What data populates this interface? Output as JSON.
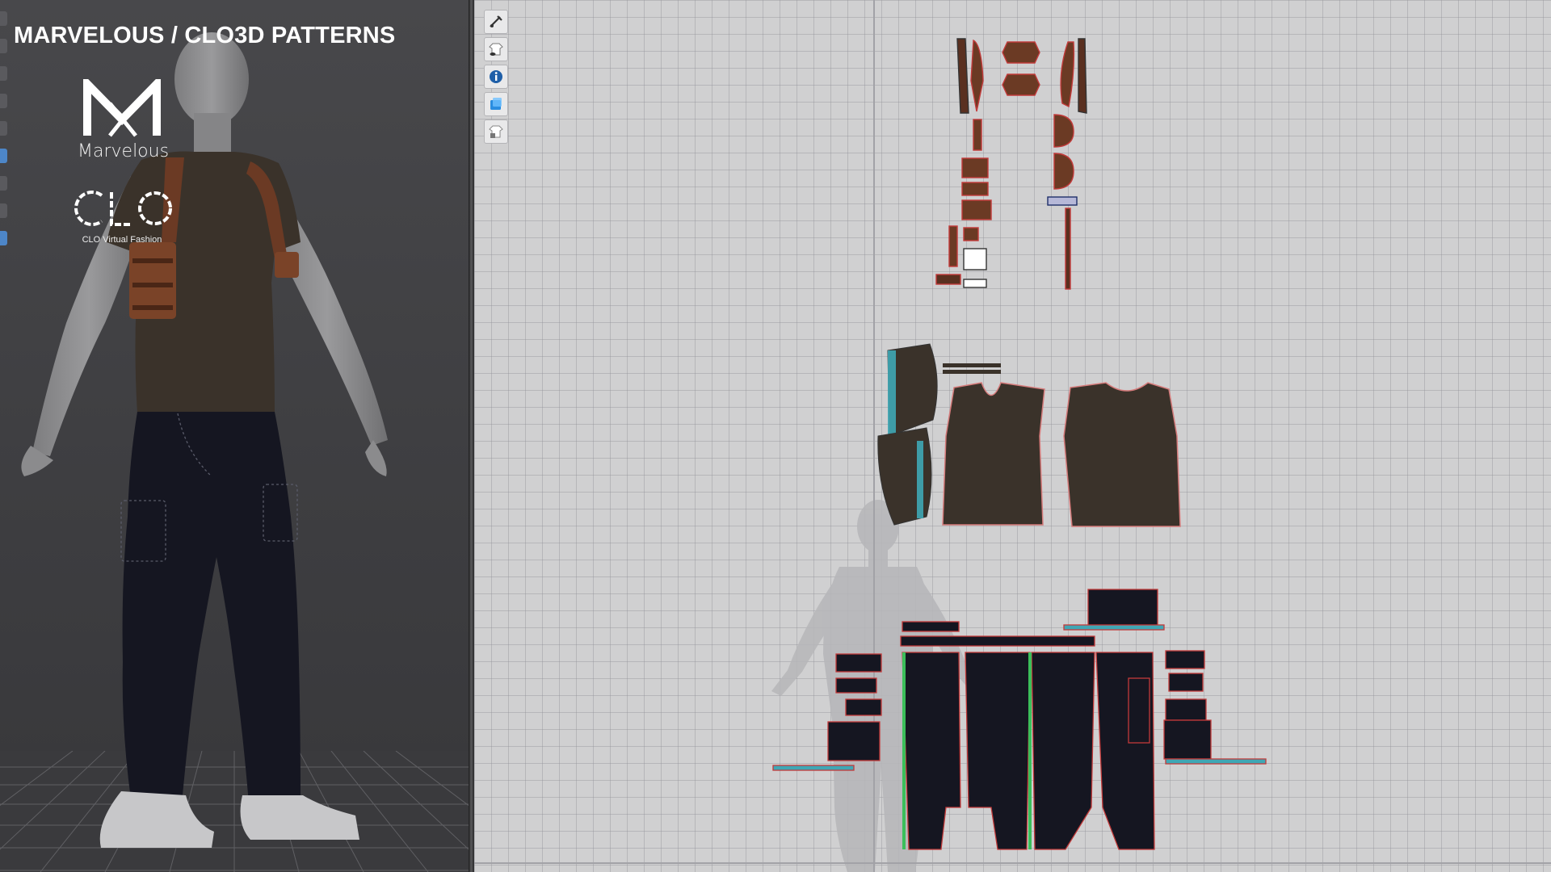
{
  "header": {
    "title": "MARVELOUS / CLO3D PATTERNS"
  },
  "brand": {
    "marvelous_label": "Marvelous",
    "clo_label": "CLO",
    "clo_tagline": "CLO Virtual Fashion"
  },
  "colors": {
    "bg3d": "#3f3f42",
    "grid2d": "#d0d0d1",
    "shirt": "#3a322a",
    "leather": "#6b3a24",
    "pants": "#151621",
    "seam": "#c23a3a",
    "accent": "#3fa7b5"
  },
  "toolbar": {
    "icons": [
      "sewing-tool-icon",
      "avatar-visibility-icon",
      "info-icon",
      "texture-icon",
      "lock-garment-icon"
    ]
  },
  "left_toolbar": {
    "count": 9
  }
}
